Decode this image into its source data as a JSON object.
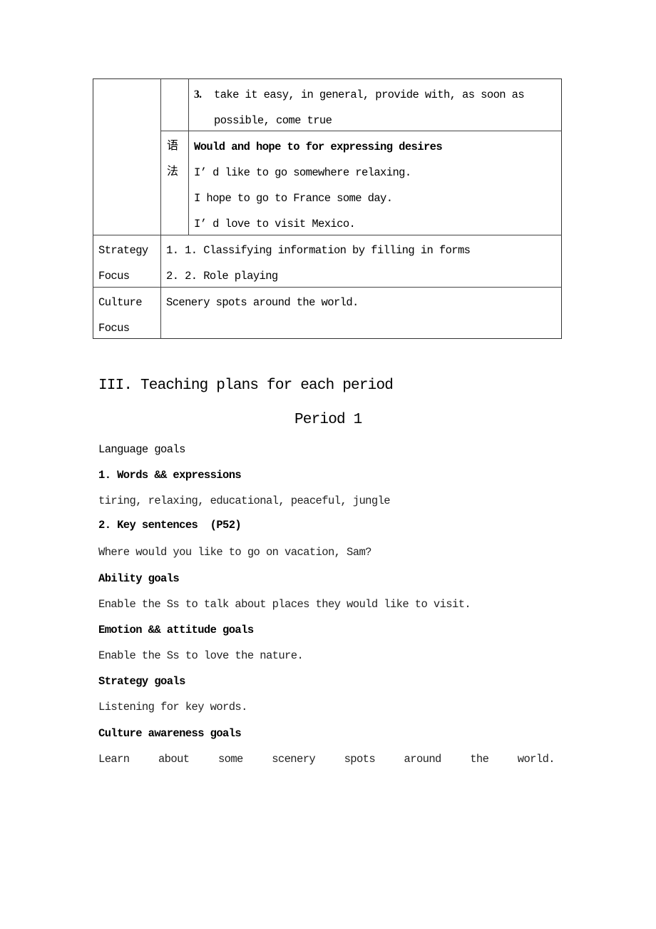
{
  "table": {
    "phrases_row": {
      "number": "3.",
      "line1": "take it easy, in general, provide with, as soon as",
      "line2": "possible, come true"
    },
    "grammar_row": {
      "label_char1": "语",
      "label_char2": "法",
      "heading": "Would and hope to for expressing desires",
      "examples": [
        "I’ d like to go somewhere relaxing.",
        "I hope to go to France some day.",
        "I’ d love to visit Mexico."
      ]
    },
    "strategy_row": {
      "label_line1": "Strategy",
      "label_line2": "Focus",
      "items": [
        "1. 1. Classifying information by filling in forms",
        "2. 2. Role playing"
      ]
    },
    "culture_row": {
      "label_line1": "Culture",
      "label_line2": "Focus",
      "text": "Scenery spots around the world."
    }
  },
  "section": {
    "heading": "III. Teaching plans for each period",
    "period_title": "Period 1",
    "language_goals_label": "Language goals",
    "words_heading": "1. Words && expressions",
    "words_text": "tiring, relaxing, educational, peaceful, jungle",
    "key_sentences_heading": "2. Key sentences  (P52)",
    "key_sentence": "Where would you like to go on vacation, Sam?",
    "ability_heading": "Ability goals",
    "ability_text": "Enable the Ss to talk about places they would like to visit.",
    "emotion_heading": "Emotion && attitude goals",
    "emotion_text": "Enable the Ss to love the nature.",
    "strategy_heading": "Strategy goals",
    "strategy_text": "Listening for key words.",
    "culture_heading": "Culture awareness goals",
    "culture_words": [
      "Learn",
      "about",
      "some",
      "scenery",
      "spots",
      "around",
      "the",
      "world."
    ]
  }
}
